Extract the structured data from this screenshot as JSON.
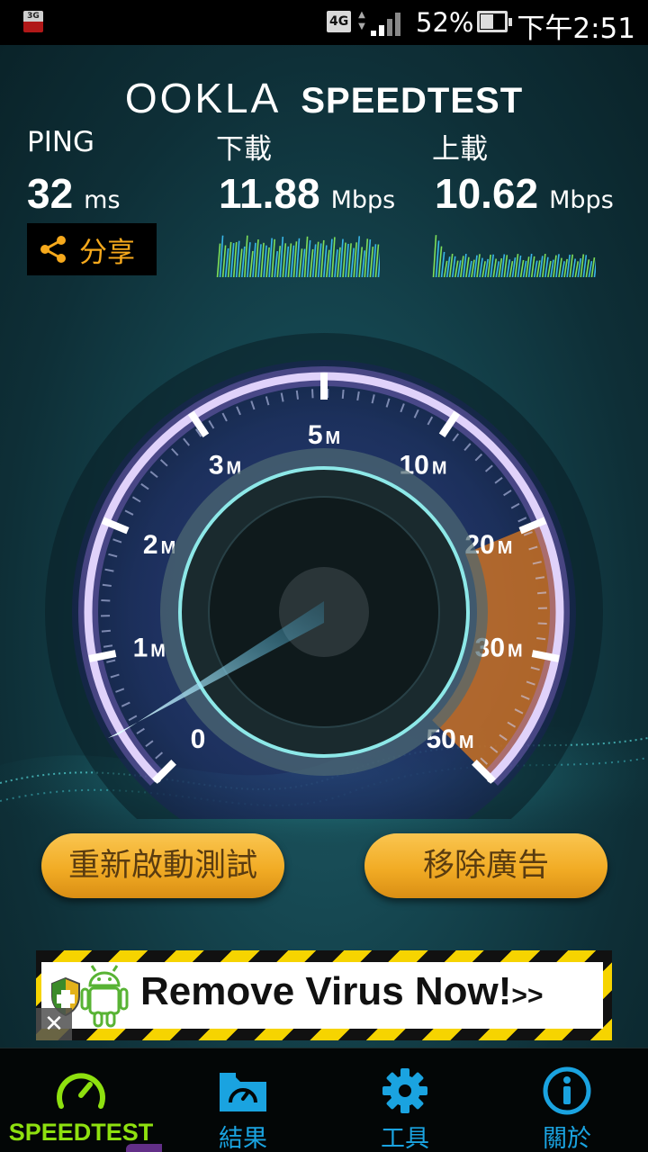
{
  "status_bar": {
    "left_badge": "3G",
    "network": "4G",
    "battery_percent": "52%",
    "battery_level": 0.52,
    "time": "下午2:51"
  },
  "header": {
    "brand_left": "OOKLA",
    "brand_right": "SPEEDTEST"
  },
  "metrics": {
    "ping_label": "PING",
    "ping_value": "32",
    "ping_unit": "ms",
    "download_label": "下載",
    "download_value": "11.88",
    "download_unit": "Mbps",
    "upload_label": "上載",
    "upload_value": "10.62",
    "upload_unit": "Mbps"
  },
  "share_button": {
    "label": "分享",
    "icon": "share-icon"
  },
  "gauge": {
    "ticks": [
      {
        "num": "0",
        "unit": ""
      },
      {
        "num": "1",
        "unit": "M"
      },
      {
        "num": "2",
        "unit": "M"
      },
      {
        "num": "3",
        "unit": "M"
      },
      {
        "num": "5",
        "unit": "M"
      },
      {
        "num": "10",
        "unit": "M"
      },
      {
        "num": "20",
        "unit": "M"
      },
      {
        "num": "30",
        "unit": "M"
      },
      {
        "num": "50",
        "unit": "M"
      }
    ],
    "needle_value": "0"
  },
  "buttons": {
    "restart": "重新啟動測試",
    "remove_ads": "移除廣告"
  },
  "ad": {
    "text": "Remove Virus Now!",
    "suffix": ">>",
    "close": "✕"
  },
  "nav": {
    "items": [
      {
        "label": "SPEEDTEST",
        "icon": "speedometer-icon",
        "active": true
      },
      {
        "label": "結果",
        "icon": "results-folder-icon",
        "active": false
      },
      {
        "label": "工具",
        "icon": "gear-icon",
        "active": false
      },
      {
        "label": "關於",
        "icon": "info-icon",
        "active": false
      }
    ]
  },
  "colors": {
    "accent_orange": "#f2ac25",
    "nav_blue": "#1aa3e0",
    "nav_active_green": "#8ee00f",
    "graph_green": "#7ee05a",
    "graph_blue": "#39b7e8"
  }
}
